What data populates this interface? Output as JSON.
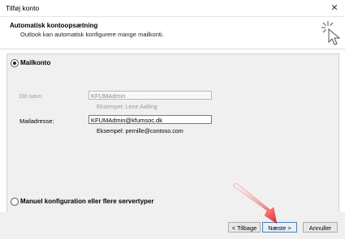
{
  "window": {
    "title": "Tilføj konto",
    "close_glyph": "✕"
  },
  "header": {
    "title": "Automatisk kontoopsætning",
    "subtitle": "Outlook kan automatisk konfigurere mange mailkonti.",
    "icon": "cursor-click-icon"
  },
  "options": {
    "mail_account_label": "Mailkonto",
    "manual_label": "Manuel konfiguration eller flere servertyper",
    "selected": "mail_account"
  },
  "form": {
    "name_label": "Dit navn",
    "name_value": "KFUMAdmin",
    "name_example": "Eksempel: Lene Aalling",
    "email_label": "Mailadresse:",
    "email_value": "KFUMAdmin@kfumsoc.dk",
    "email_example": "Eksempel: pernille@contoso.com"
  },
  "buttons": {
    "back": "< Tilbage",
    "next": "Næste >",
    "cancel": "Annuller"
  },
  "annotation": {
    "arrow_color": "#e8201c"
  }
}
